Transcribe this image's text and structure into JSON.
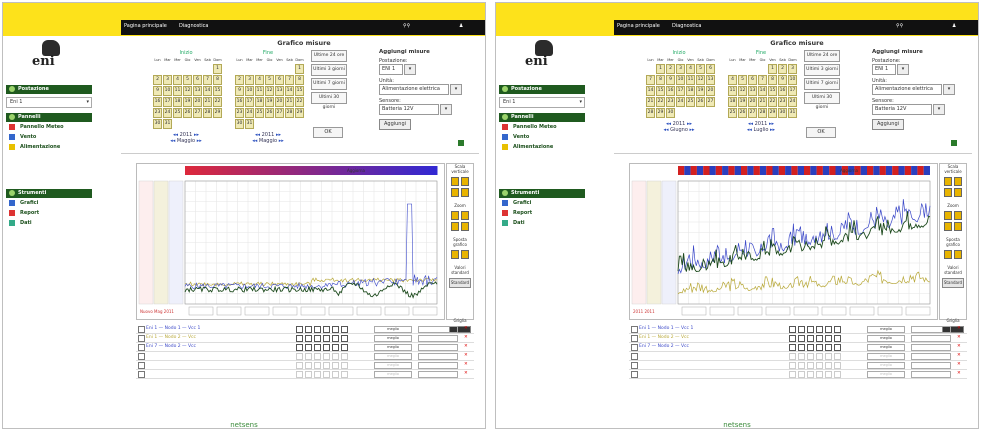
{
  "panels": [
    {
      "header": {
        "breadcrumb": "Pagina principale",
        "section": "Diagnostica"
      },
      "title": "Grafico misure",
      "brand": "eni",
      "sidebar": {
        "postazione_title": "Postazione",
        "postazione_value": "Eni 1",
        "pannelli_title": "Pannelli",
        "pannelli_items": [
          "Pannello Meteo",
          "Vento",
          "Alimentazione"
        ],
        "strumenti_title": "Strumenti",
        "strumenti_items": [
          "Grafici",
          "Report",
          "Dati"
        ]
      },
      "cal_start": {
        "label": "Inizio",
        "weekdays": [
          "Lun",
          "Mar",
          "Mer",
          "Gio",
          "Ven",
          "Sab",
          "Dom"
        ],
        "offset": 6,
        "days": 31,
        "month": "Maggio",
        "year": "2011"
      },
      "cal_end": {
        "label": "Fine",
        "weekdays": [
          "Lun",
          "Mar",
          "Mer",
          "Gio",
          "Ven",
          "Sab",
          "Dom"
        ],
        "offset": 6,
        "days": 31,
        "month": "Maggio",
        "year": "2011"
      },
      "quick": [
        "Ultime 24 ore",
        "Ultimi 3 giorni",
        "Ultimi 7 giorni",
        "Ultimi 30 giorni"
      ],
      "ok": "OK",
      "add": {
        "title": "Aggiungi misure",
        "postazione_label": "Postazione:",
        "postazione_value": "ENI 1",
        "unita_label": "Unità:",
        "unita_value": "Alimentazione elettrica",
        "sensore_label": "Sensore:",
        "sensore_value": "Batteria 12V",
        "button": "Aggiungi"
      },
      "chart": {
        "update": "Aggiorna",
        "end_label": "Nuovo Mag 2011",
        "colors": {
          "blue": "#3b48c8",
          "dark": "#1d4a1d",
          "olive": "#b8a838"
        }
      },
      "controls": {
        "scale": "Scala verticale",
        "zoom": "Zoom",
        "move": "Sposta grafico",
        "reset": "Valori standard",
        "reset_btn": "Standard",
        "grid": "Griglia"
      },
      "rows": [
        {
          "label": "Eni 1 — Nodo 1 — Vcc 1",
          "color": "#3b48c8",
          "field": "meglio",
          "enabled": true
        },
        {
          "label": "Eni 1 — Nodo 2 — Vcc",
          "color": "#b8a838",
          "field": "meglio",
          "enabled": true
        },
        {
          "label": "Eni 7 — Nodo 2 — Vcc",
          "color": "#3b48c8",
          "field": "meglio",
          "enabled": true
        },
        {
          "label": "",
          "color": "#999",
          "field": "meglio",
          "enabled": false
        },
        {
          "label": "",
          "color": "#999",
          "field": "meglio",
          "enabled": false
        },
        {
          "label": "",
          "color": "#999",
          "field": "meglio",
          "enabled": false
        }
      ],
      "footer": "netsens"
    },
    {
      "header": {
        "breadcrumb": "Pagina principale",
        "section": "Diagnostica"
      },
      "title": "Grafico misure",
      "brand": "eni",
      "sidebar": {
        "postazione_title": "Postazione",
        "postazione_value": "Eni 1",
        "pannelli_title": "Pannelli",
        "pannelli_items": [
          "Pannello Meteo",
          "Vento",
          "Alimentazione"
        ],
        "strumenti_title": "Strumenti",
        "strumenti_items": [
          "Grafici",
          "Report",
          "Dati"
        ]
      },
      "cal_start": {
        "label": "Inizio",
        "weekdays": [
          "Lun",
          "Mar",
          "Mer",
          "Gio",
          "Ven",
          "Sab",
          "Dom"
        ],
        "offset": 1,
        "days": 30,
        "month": "Giugno",
        "year": "2011"
      },
      "cal_end": {
        "label": "Fine",
        "weekdays": [
          "Lun",
          "Mar",
          "Mer",
          "Gio",
          "Ven",
          "Sab",
          "Dom"
        ],
        "offset": 4,
        "days": 31,
        "month": "Luglio",
        "year": "2011"
      },
      "quick": [
        "Ultime 24 ore",
        "Ultimi 3 giorni",
        "Ultimi 7 giorni",
        "Ultimi 30 giorni"
      ],
      "ok": "OK",
      "add": {
        "title": "Aggiungi misure",
        "postazione_label": "Postazione:",
        "postazione_value": "ENI 1",
        "unita_label": "Unità:",
        "unita_value": "Alimentazione elettrica",
        "sensore_label": "Sensore:",
        "sensore_value": "Batteria 12V",
        "button": "Aggiungi"
      },
      "chart": {
        "update": "Aggiorna",
        "end_label": "2011 2011",
        "colors": {
          "blue": "#3b48c8",
          "dark": "#1d4a1d",
          "olive": "#b8a838"
        }
      },
      "controls": {
        "scale": "Scala verticale",
        "zoom": "Zoom",
        "move": "Sposta grafico",
        "reset": "Valori standard",
        "reset_btn": "Standard",
        "grid": "Griglia"
      },
      "rows": [
        {
          "label": "Eni 1 — Nodo 1 — Vcc 1",
          "color": "#3b48c8",
          "field": "meglio",
          "enabled": true
        },
        {
          "label": "Eni 1 — Nodo 2 — Vcc",
          "color": "#b8a838",
          "field": "meglio",
          "enabled": true
        },
        {
          "label": "Eni 7 — Nodo 2 — Vcc",
          "color": "#3b48c8",
          "field": "meglio",
          "enabled": true
        },
        {
          "label": "",
          "color": "#999",
          "field": "meglio",
          "enabled": false
        },
        {
          "label": "",
          "color": "#999",
          "field": "meglio",
          "enabled": false
        },
        {
          "label": "",
          "color": "#999",
          "field": "meglio",
          "enabled": false
        }
      ],
      "footer": "netsens"
    }
  ]
}
